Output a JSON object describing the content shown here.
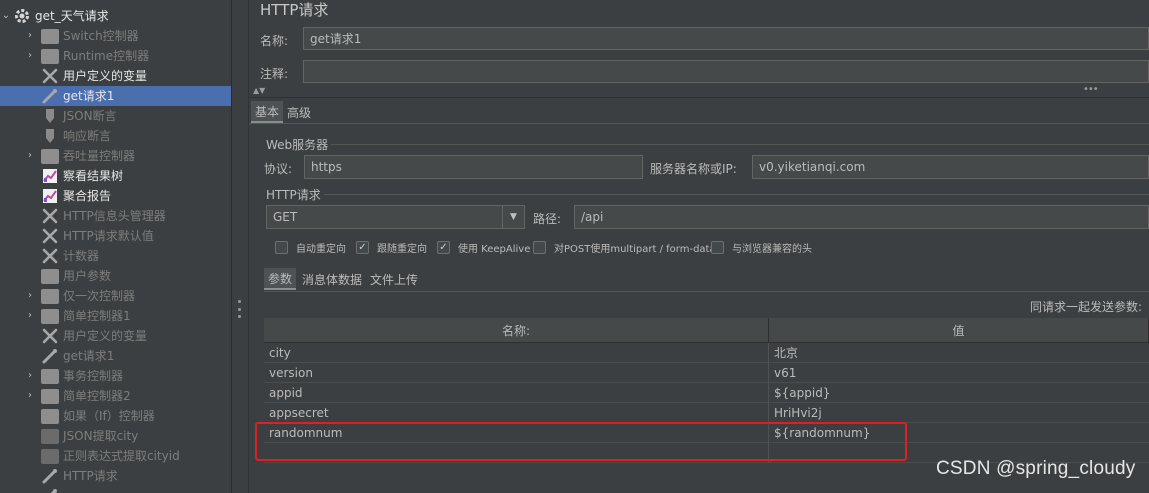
{
  "tree": {
    "root": {
      "label": "get_天气请求"
    },
    "items": [
      {
        "label": "Switch控制器",
        "has_arrow": true,
        "enabled": false,
        "icon": "controller"
      },
      {
        "label": "Runtime控制器",
        "has_arrow": true,
        "enabled": false,
        "icon": "controller"
      },
      {
        "label": "用户定义的变量",
        "has_arrow": false,
        "enabled": true,
        "icon": "wrench"
      },
      {
        "label": "get请求1",
        "has_arrow": false,
        "enabled": true,
        "icon": "pipette",
        "selected": true
      },
      {
        "label": "JSON断言",
        "has_arrow": false,
        "enabled": false,
        "icon": "assertion"
      },
      {
        "label": "响应断言",
        "has_arrow": false,
        "enabled": false,
        "icon": "assertion"
      },
      {
        "label": "吞吐量控制器",
        "has_arrow": true,
        "enabled": false,
        "icon": "controller"
      },
      {
        "label": "察看结果树",
        "has_arrow": false,
        "enabled": true,
        "icon": "chart"
      },
      {
        "label": "聚合报告",
        "has_arrow": false,
        "enabled": true,
        "icon": "chart"
      },
      {
        "label": "HTTP信息头管理器",
        "has_arrow": false,
        "enabled": false,
        "icon": "wrench"
      },
      {
        "label": "HTTP请求默认值",
        "has_arrow": false,
        "enabled": false,
        "icon": "wrench"
      },
      {
        "label": "计数器",
        "has_arrow": false,
        "enabled": false,
        "icon": "wrench"
      },
      {
        "label": "用户参数",
        "has_arrow": false,
        "enabled": false,
        "icon": "controller"
      },
      {
        "label": "仅一次控制器",
        "has_arrow": true,
        "enabled": false,
        "icon": "controller"
      },
      {
        "label": "简单控制器1",
        "has_arrow": true,
        "enabled": false,
        "icon": "controller"
      },
      {
        "label": "用户定义的变量",
        "has_arrow": false,
        "enabled": false,
        "icon": "wrench"
      },
      {
        "label": "get请求1",
        "has_arrow": false,
        "enabled": false,
        "icon": "pipette"
      },
      {
        "label": "事务控制器",
        "has_arrow": true,
        "enabled": false,
        "icon": "controller"
      },
      {
        "label": "简单控制器2",
        "has_arrow": true,
        "enabled": false,
        "icon": "controller"
      },
      {
        "label": "如果（If）控制器",
        "has_arrow": false,
        "enabled": false,
        "icon": "controller"
      },
      {
        "label": "JSON提取city",
        "has_arrow": false,
        "enabled": false,
        "icon": "extractor"
      },
      {
        "label": "正则表达式提取cityid",
        "has_arrow": false,
        "enabled": false,
        "icon": "extractor"
      },
      {
        "label": "HTTP请求",
        "has_arrow": false,
        "enabled": false,
        "icon": "pipette"
      }
    ]
  },
  "panel": {
    "title": "HTTP请求",
    "name_label": "名称:",
    "name_value": "get请求1",
    "comment_label": "注释:",
    "comment_value": "",
    "tabs": [
      "基本",
      "高级"
    ],
    "web_server": {
      "group_title": "Web服务器",
      "protocol_label": "协议:",
      "protocol_value": "https",
      "server_label": "服务器名称或IP:",
      "server_value": "v0.yiketianqi.com"
    },
    "http_request": {
      "group_title": "HTTP请求",
      "method_value": "GET",
      "path_label": "路径:",
      "path_value": "/api"
    },
    "checkboxes": [
      {
        "label": "自动重定向",
        "checked": false
      },
      {
        "label": "跟随重定向",
        "checked": true
      },
      {
        "label": "使用 KeepAlive",
        "checked": true
      },
      {
        "label": "对POST使用multipart / form-data",
        "checked": false
      },
      {
        "label": "与浏览器兼容的头",
        "checked": false
      }
    ],
    "sub_tabs": [
      "参数",
      "消息体数据",
      "文件上传"
    ],
    "send_params_label": "同请求一起发送参数:",
    "table": {
      "headers": [
        "名称:",
        "值"
      ],
      "rows": [
        {
          "name": "city",
          "value": "北京"
        },
        {
          "name": "version",
          "value": "v61"
        },
        {
          "name": "appid",
          "value": "${appid}"
        },
        {
          "name": "appsecret",
          "value": "HriHvi2j"
        },
        {
          "name": "randomnum",
          "value": "${randomnum}"
        }
      ]
    }
  },
  "watermark": "CSDN @spring_cloudy"
}
